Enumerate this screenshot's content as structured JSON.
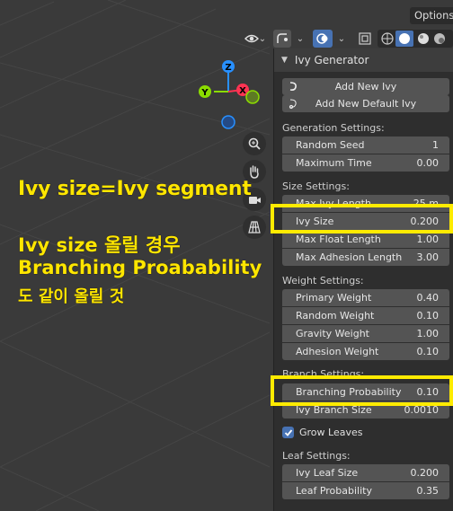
{
  "header": {
    "options_label": "Options"
  },
  "gizmo": {
    "x_label": "X",
    "y_label": "Y",
    "z_label": "Z",
    "colors": {
      "x": "#ff3352",
      "y": "#8bdc00",
      "z": "#2890ff"
    }
  },
  "annotation": {
    "line1": "Ivy size=Ivy segment",
    "line2": "Ivy size 올릴 경우",
    "line3": "Branching Proabability",
    "line4": "도 같이 올릴 것",
    "color": "#ffe600"
  },
  "panel": {
    "title": "Ivy Generator",
    "add_new_ivy": "Add New Ivy",
    "add_new_default_ivy": "Add New Default Ivy",
    "generation": {
      "label": "Generation Settings:",
      "fields": [
        {
          "name": "Random Seed",
          "value": "1"
        },
        {
          "name": "Maximum Time",
          "value": "0.00"
        }
      ]
    },
    "size": {
      "label": "Size Settings:",
      "fields": [
        {
          "name": "Max Ivy Length",
          "value": "25 m"
        },
        {
          "name": "Ivy Size",
          "value": "0.200"
        },
        {
          "name": "Max Float Length",
          "value": "1.00"
        },
        {
          "name": "Max Adhesion Length",
          "value": "3.00"
        }
      ]
    },
    "weight": {
      "label": "Weight Settings:",
      "fields": [
        {
          "name": "Primary Weight",
          "value": "0.40"
        },
        {
          "name": "Random Weight",
          "value": "0.10"
        },
        {
          "name": "Gravity Weight",
          "value": "1.00"
        },
        {
          "name": "Adhesion Weight",
          "value": "0.10"
        }
      ]
    },
    "branch": {
      "label": "Branch Settings:",
      "fields": [
        {
          "name": "Branching Probability",
          "value": "0.10"
        },
        {
          "name": "Ivy Branch Size",
          "value": "0.0010"
        }
      ]
    },
    "grow_leaves": {
      "label": "Grow Leaves",
      "checked": true
    },
    "leaf": {
      "label": "Leaf Settings:",
      "fields": [
        {
          "name": "Ivy Leaf Size",
          "value": "0.200"
        },
        {
          "name": "Leaf Probability",
          "value": "0.35"
        }
      ]
    }
  },
  "highlight_color": "#ffeb00"
}
